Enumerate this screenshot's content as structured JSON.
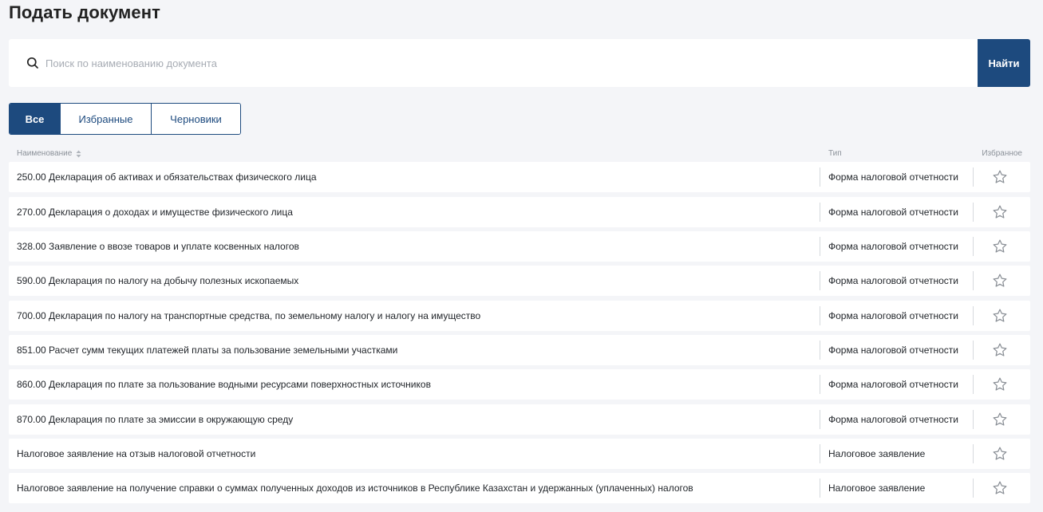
{
  "page": {
    "title": "Подать документ"
  },
  "search": {
    "placeholder": "Поиск по наименованию документа",
    "value": "",
    "button_label": "Найти",
    "icon": "search-icon"
  },
  "tabs": [
    {
      "label": "Все",
      "active": true
    },
    {
      "label": "Избранные",
      "active": false
    },
    {
      "label": "Черновики",
      "active": false
    }
  ],
  "table": {
    "columns": {
      "name": "Наименование",
      "type": "Тип",
      "favorite": "Избранное"
    },
    "rows": [
      {
        "name": "250.00 Декларация об активах и обязательствах физического лица",
        "type": "Форма налоговой отчетности",
        "favorite": false
      },
      {
        "name": "270.00 Декларация о доходах и имуществе физического лица",
        "type": "Форма налоговой отчетности",
        "favorite": false
      },
      {
        "name": "328.00 Заявление о ввозе товаров и уплате косвенных налогов",
        "type": "Форма налоговой отчетности",
        "favorite": false
      },
      {
        "name": "590.00 Декларация по налогу на добычу полезных ископаемых",
        "type": "Форма налоговой отчетности",
        "favorite": false
      },
      {
        "name": "700.00 Декларация по налогу на транспортные средства, по земельному налогу и налогу на имущество",
        "type": "Форма налоговой отчетности",
        "favorite": false
      },
      {
        "name": "851.00 Расчет сумм текущих платежей платы за пользование земельными участками",
        "type": "Форма налоговой отчетности",
        "favorite": false
      },
      {
        "name": "860.00 Декларация по плате за пользование водными ресурсами поверхностных источников",
        "type": "Форма налоговой отчетности",
        "favorite": false
      },
      {
        "name": "870.00 Декларация по плате за эмиссии в окружающую среду",
        "type": "Форма налоговой отчетности",
        "favorite": false
      },
      {
        "name": "Налоговое заявление на отзыв налоговой отчетности",
        "type": "Налоговое заявление",
        "favorite": false
      },
      {
        "name": "Налоговое заявление на получение справки о суммах полученных доходов из источников в Республике Казахстан и удержанных (уплаченных) налогов",
        "type": "Налоговое заявление",
        "favorite": false
      }
    ]
  },
  "colors": {
    "accent": "#1d4a7e",
    "background": "#f4f5f8",
    "star": "#8a8f96"
  }
}
